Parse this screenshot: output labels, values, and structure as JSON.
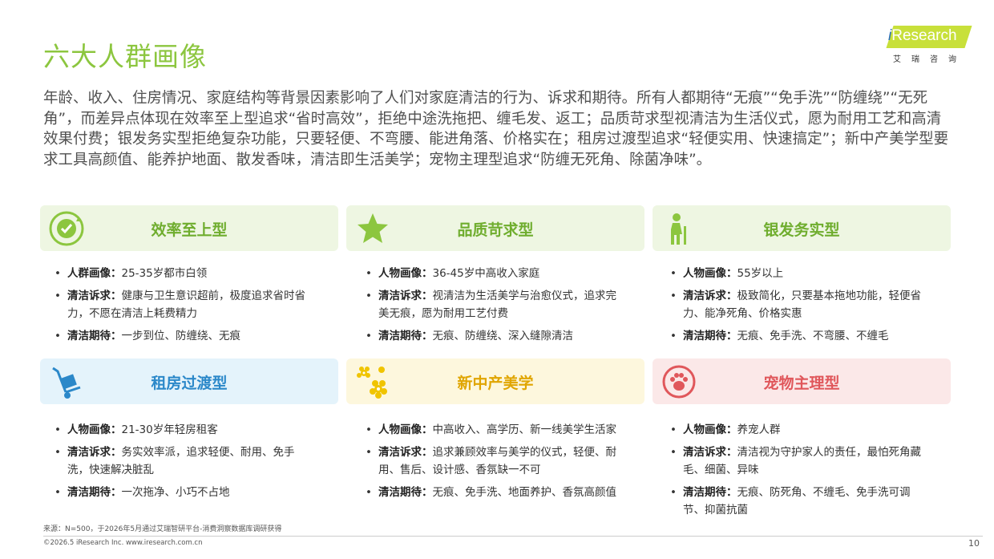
{
  "title": "六大人群画像",
  "logo": {
    "text_i": "i",
    "text_rest": "Research",
    "sub": "艾瑞咨询"
  },
  "intro": "年龄、收入、住房情况、家庭结构等背景因素影响了人们对家庭清洁的行为、诉求和期待。所有人都期待“无痕”“免手洗”“防缠绕”“无死角”，而差异点体现在效率至上型追求“省时高效”，拒绝中途洗拖把、缠毛发、返工；品质苛求型视清洁为生活仪式，愿为耐用工艺和高清效果付费；银发务实型拒绝复杂功能，只要轻便、不弯腰、能进角落、价格实在；租房过渡型追求“轻便实用、快速搞定”；新中产美学型要求工具高颜值、能养护地面、散发香味，清洁即生活美学；宠物主理型追求“防缠无死角、除菌净味”。",
  "colors": {
    "green": "#8cc63f",
    "blue": "#2b88c9",
    "yellow": "#e0a500",
    "pink": "#e0575b"
  },
  "segments": [
    {
      "name": "效率至上型",
      "icon": "clock-cycle-icon",
      "items": [
        {
          "key": "人群画像：",
          "value": "25-35岁都市白领"
        },
        {
          "key": "清洁诉求：",
          "value": "健康与卫生意识超前，极度追求省时省力，不愿在清洁上耗费精力"
        },
        {
          "key": "清洁期待：",
          "value": "一步到位、防缠绕、无痕"
        }
      ]
    },
    {
      "name": "品质苛求型",
      "icon": "star-icon",
      "items": [
        {
          "key": "人物画像：",
          "value": "36-45岁中高收入家庭"
        },
        {
          "key": "清洁诉求：",
          "value": "视清洁为生活美学与治愈仪式，追求完美无痕，愿为耐用工艺付费"
        },
        {
          "key": "清洁期待：",
          "value": "无痕、防缠绕、深入缝隙清洁"
        }
      ]
    },
    {
      "name": "银发务实型",
      "icon": "elderly-person-icon",
      "items": [
        {
          "key": "人物画像：",
          "value": "55岁以上"
        },
        {
          "key": "清洁诉求：",
          "value": "极致简化，只要基本拖地功能，轻便省力、能净死角、价格实惠"
        },
        {
          "key": "清洁期待：",
          "value": "无痕、免手洗、不弯腰、不缠毛"
        }
      ]
    },
    {
      "name": "租房过渡型",
      "icon": "luggage-cart-icon",
      "items": [
        {
          "key": "人物画像：",
          "value": "21-30岁年轻房租客"
        },
        {
          "key": "清洁诉求：",
          "value": "务实效率派，追求轻便、耐用、免手洗，快速解决脏乱"
        },
        {
          "key": "清洁期待：",
          "value": "一次拖净、小巧不占地"
        }
      ]
    },
    {
      "name": "新中产美学",
      "icon": "flowers-icon",
      "items": [
        {
          "key": "人物画像：",
          "value": "中高收入、高学历、新一线美学生活家"
        },
        {
          "key": "清洁诉求：",
          "value": "追求兼顾效率与美学的仪式，轻便、耐用、售后、设计感、香氛缺一不可"
        },
        {
          "key": "清洁期待：",
          "value": "无痕、免手洗、地面养护、香氛高颜值"
        }
      ]
    },
    {
      "name": "宠物主理型",
      "icon": "paw-icon",
      "items": [
        {
          "key": "人物画像：",
          "value": "养宠人群"
        },
        {
          "key": "清洁诉求：",
          "value": "清洁视为守护家人的责任，最怕死角藏毛、细菌、异味"
        },
        {
          "key": "清洁期待：",
          "value": "无痕、防死角、不缠毛、免手洗可调节、抑菌抗菌"
        }
      ]
    }
  ],
  "source": "来源：N=500，于2026年5月通过艾瑞智研平台-消费洞察数据库调研获得",
  "copyright": "©2026.5 iResearch Inc.                 www.iresearch.com.cn",
  "page_number": "10"
}
